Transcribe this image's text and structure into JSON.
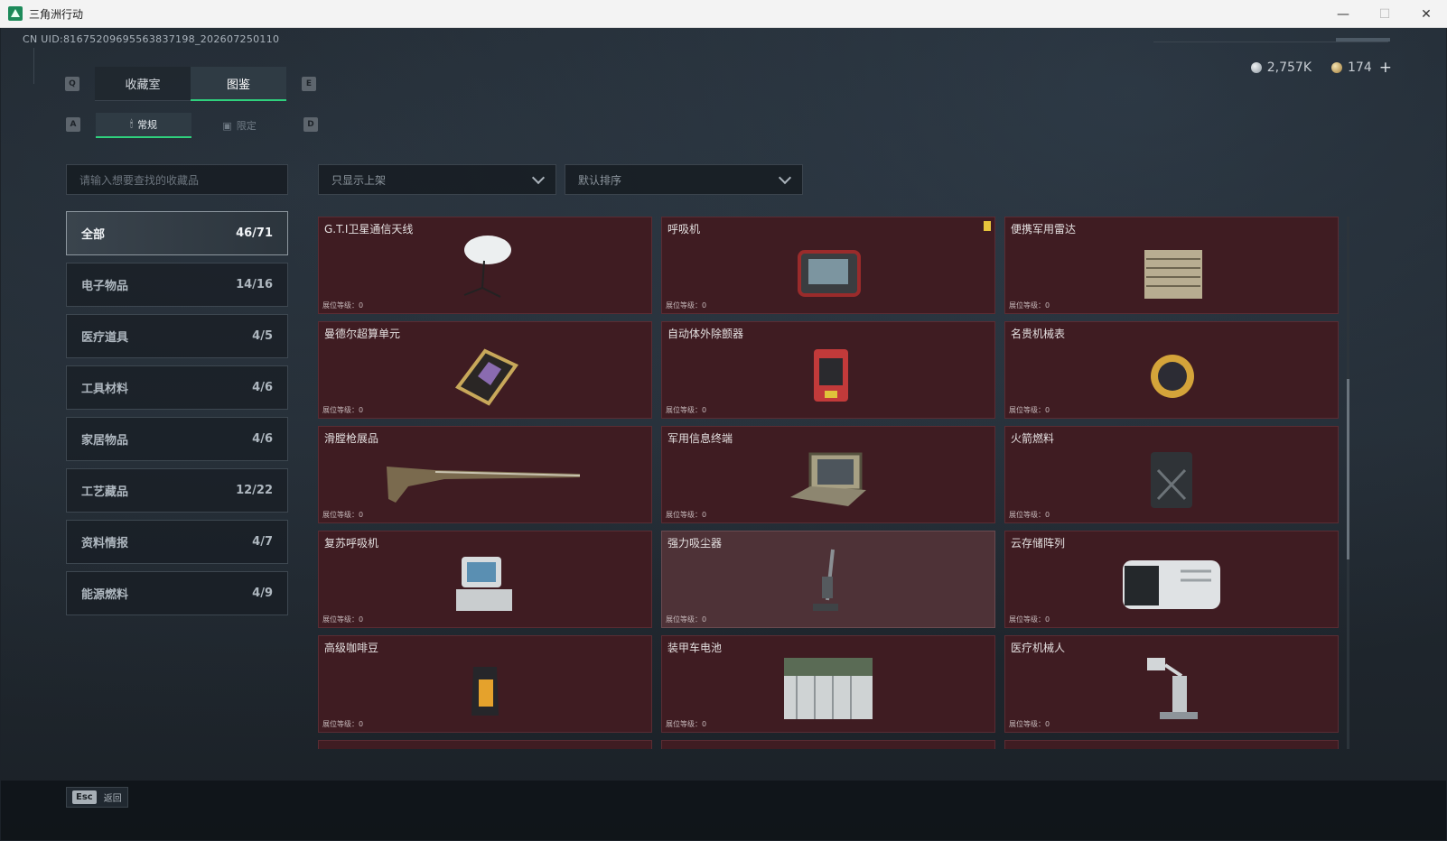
{
  "window": {
    "title": "三角洲行动",
    "controls": {
      "minimize": "—",
      "maximize": "☐",
      "close": "✕"
    }
  },
  "header": {
    "uid": "CN UID:816752096955638371​98_202607250110",
    "currency": [
      {
        "icon": "silver-coin-icon",
        "value": "2,757K"
      },
      {
        "icon": "gold-coin-icon",
        "value": "174"
      }
    ],
    "plus": "+"
  },
  "hotkeys": {
    "tab_prev": "Q",
    "tab_next": "E",
    "sub_prev": "A",
    "sub_next": "D"
  },
  "tabs": [
    {
      "label": "收藏室",
      "active": false
    },
    {
      "label": "图鉴",
      "active": true
    }
  ],
  "subtabs": [
    {
      "label": "常规",
      "icon": "flame-icon",
      "active": true
    },
    {
      "label": "限定",
      "icon": "image-icon",
      "active": false
    }
  ],
  "search": {
    "placeholder": "请输入想要查找的收藏品"
  },
  "filters": {
    "shelf": "只显示上架",
    "sort": "默认排序"
  },
  "categories": [
    {
      "label": "全部",
      "count": "46/71",
      "active": true
    },
    {
      "label": "电子物品",
      "count": "14/16"
    },
    {
      "label": "医疗道具",
      "count": "4/5"
    },
    {
      "label": "工具材料",
      "count": "4/6"
    },
    {
      "label": "家居物品",
      "count": "4/6"
    },
    {
      "label": "工艺藏品",
      "count": "12/22"
    },
    {
      "label": "资料情报",
      "count": "4/7"
    },
    {
      "label": "能源燃料",
      "count": "4/9"
    }
  ],
  "level_label": "展位等级：0",
  "items": [
    {
      "name": "G.T.I卫星通信天线",
      "icon": "satellite-dish-icon"
    },
    {
      "name": "呼吸机",
      "icon": "ventilator-icon",
      "badge": true
    },
    {
      "name": "便携军用雷达",
      "icon": "radar-icon"
    },
    {
      "name": "曼德尔超算单元",
      "icon": "supercomputer-chip-icon"
    },
    {
      "name": "自动体外除颤器",
      "icon": "defibrillator-icon"
    },
    {
      "name": "名贵机械表",
      "icon": "watch-icon"
    },
    {
      "name": "滑膛枪展品",
      "icon": "musket-icon"
    },
    {
      "name": "军用信息终端",
      "icon": "terminal-icon"
    },
    {
      "name": "火箭燃料",
      "icon": "fuel-can-icon"
    },
    {
      "name": "复苏呼吸机",
      "icon": "resuscitator-icon"
    },
    {
      "name": "强力吸尘器",
      "icon": "vacuum-icon",
      "light": true
    },
    {
      "name": "云存储阵列",
      "icon": "storage-array-icon"
    },
    {
      "name": "高级咖啡豆",
      "icon": "coffee-bag-icon"
    },
    {
      "name": "装甲车电池",
      "icon": "battery-icon"
    },
    {
      "name": "医疗机械人",
      "icon": "medical-robot-icon"
    }
  ],
  "footer": {
    "key": "Esc",
    "label": "返回"
  }
}
